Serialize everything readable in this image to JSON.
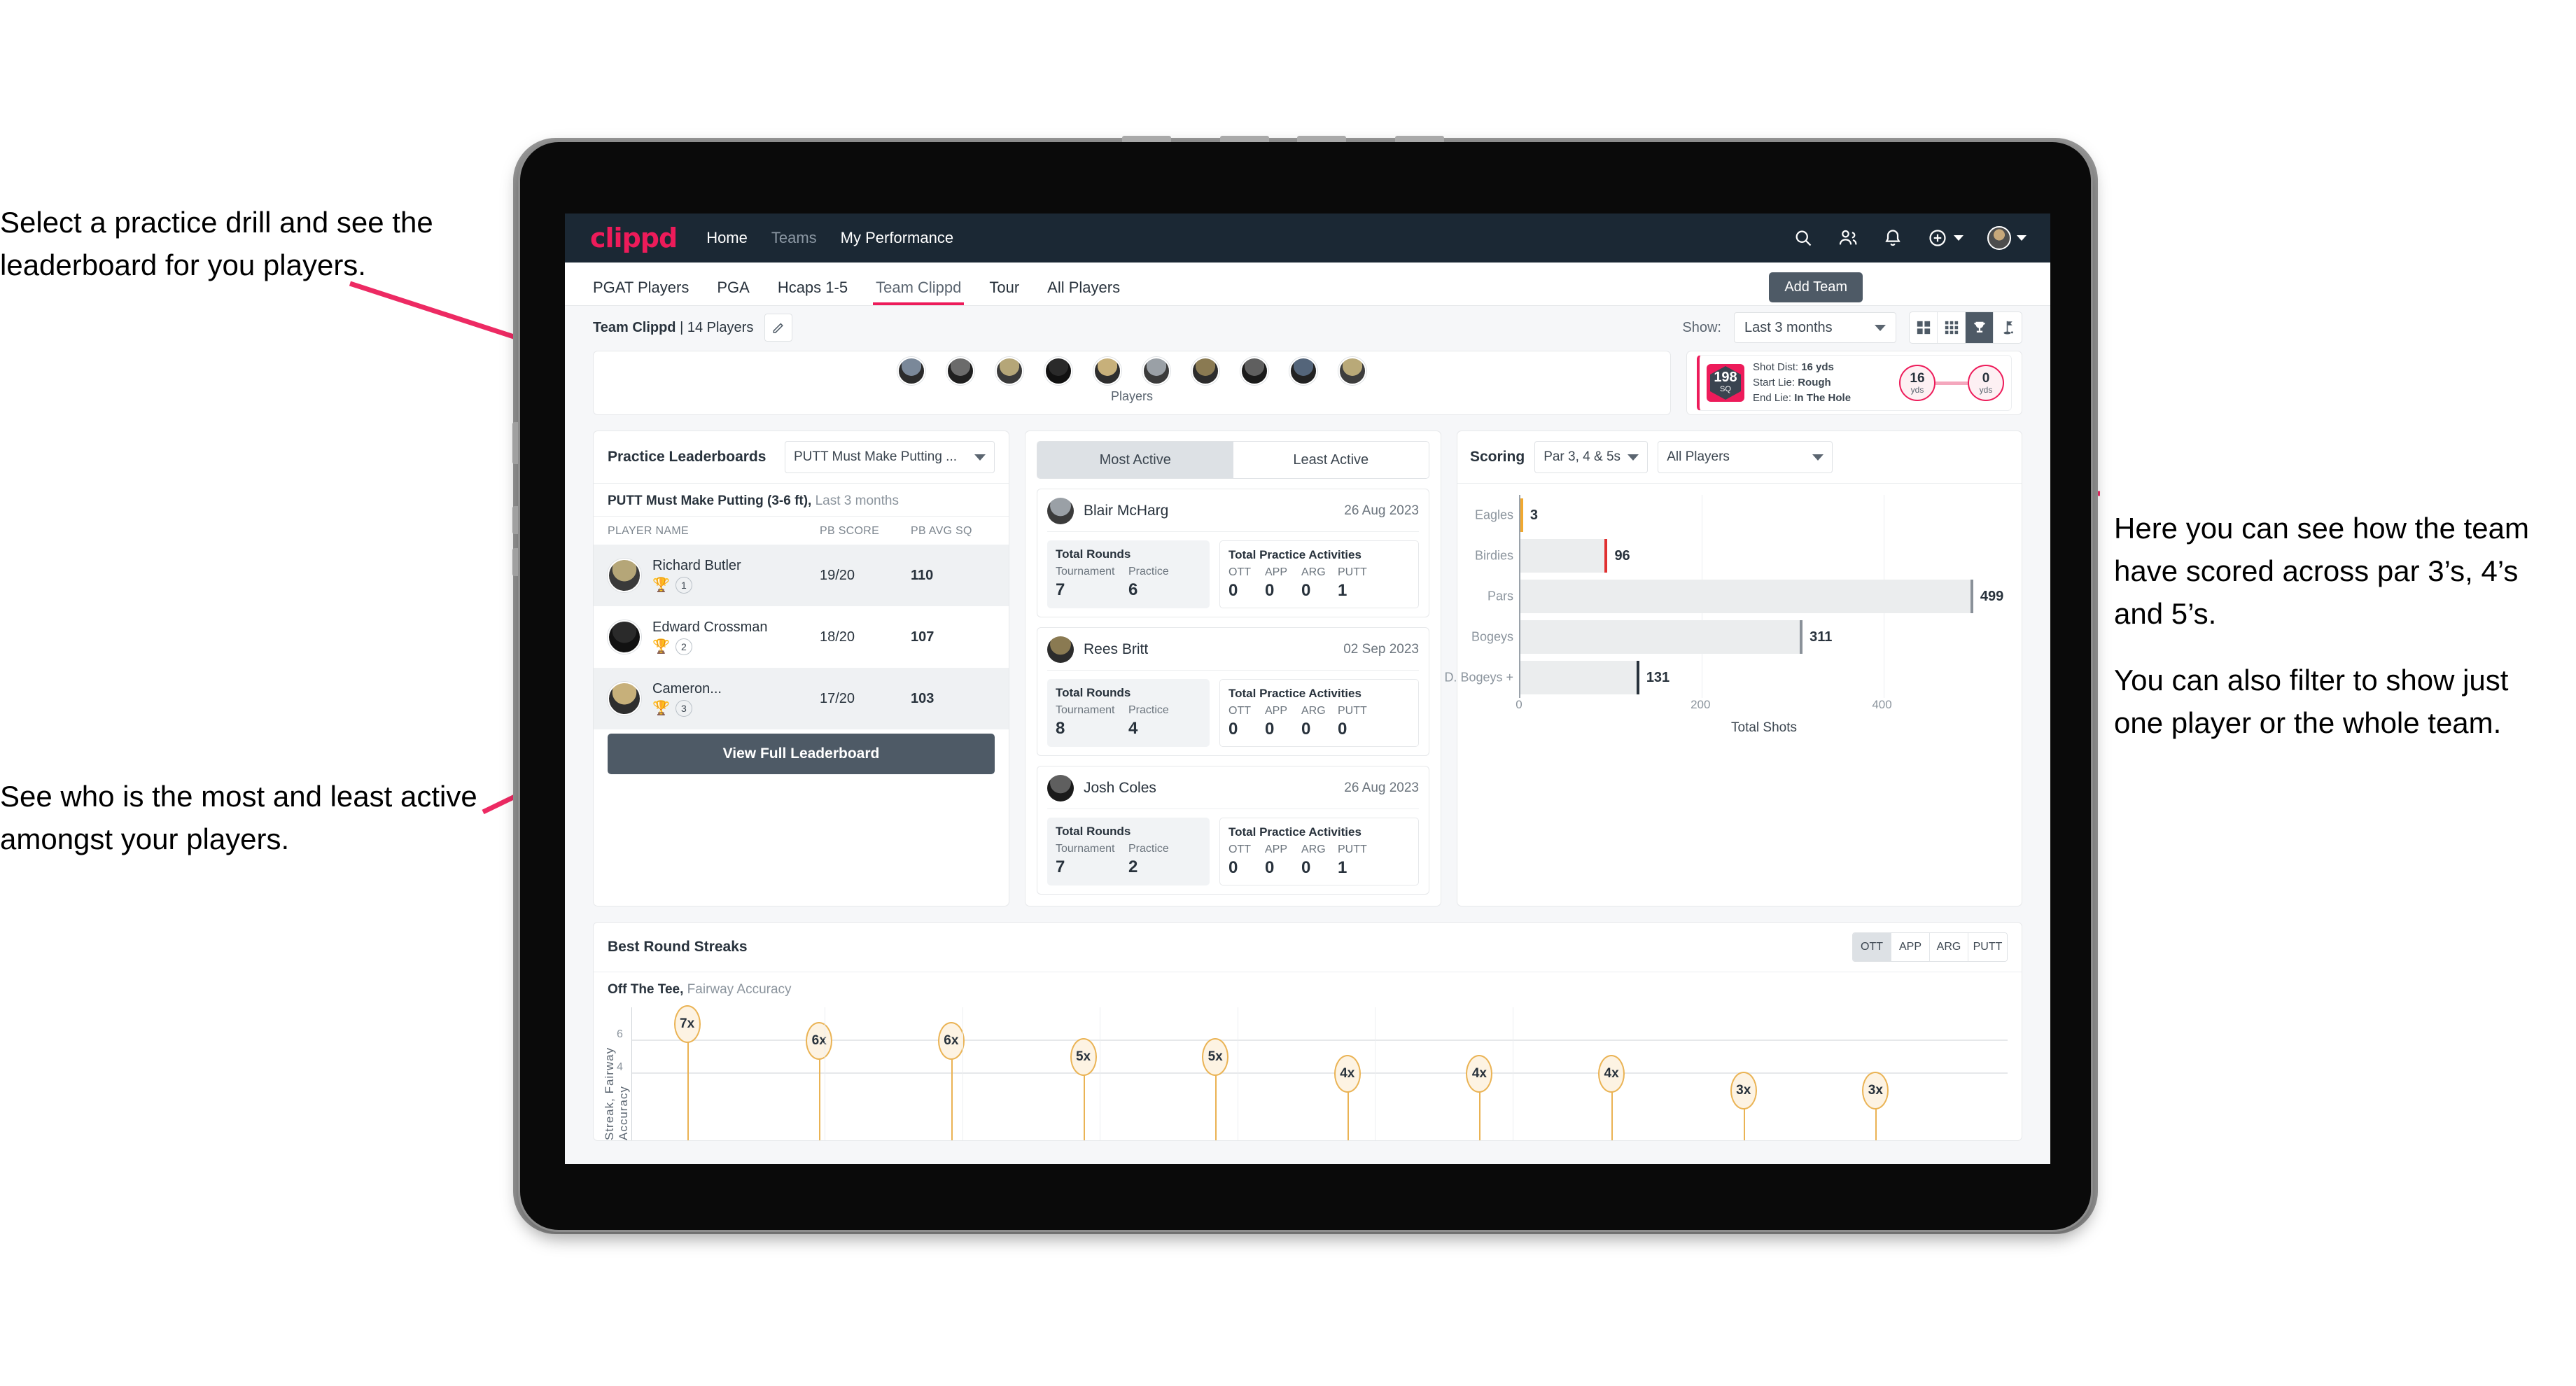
{
  "annotations": {
    "practice": "Select a practice drill and see the leaderboard for you players.",
    "active": "See who is the most and least active amongst your players.",
    "scoring_1": "Here you can see how the team have scored across par 3’s, 4’s and 5’s.",
    "scoring_2": "You can also filter to show just one player or the whole team."
  },
  "topnav": {
    "logo": "clippd",
    "links": [
      {
        "label": "Home",
        "dim": false
      },
      {
        "label": "Teams",
        "dim": true
      },
      {
        "label": "My Performance",
        "dim": false
      }
    ],
    "icons": [
      "search-icon",
      "people-icon",
      "bell-icon",
      "plus-circle-icon",
      "avatar"
    ]
  },
  "tabs": {
    "items": [
      {
        "label": "PGAT Players",
        "state": "normal"
      },
      {
        "label": "PGA",
        "state": "normal"
      },
      {
        "label": "Hcaps 1-5",
        "state": "normal"
      },
      {
        "label": "Team Clippd",
        "state": "active"
      },
      {
        "label": "Tour",
        "state": "normal"
      },
      {
        "label": "All Players",
        "state": "normal"
      }
    ],
    "add_team": "Add Team"
  },
  "subbar": {
    "team_name": "Team Clippd",
    "team_count": "| 14 Players",
    "show_label": "Show:",
    "show_value": "Last 3 months",
    "view_buttons": [
      "grid-large-icon",
      "grid-small-icon",
      "trophy-icon",
      "flag-icon"
    ],
    "view_active_index": 2
  },
  "players_strip": {
    "label": "Players",
    "count": 10
  },
  "shot_card": {
    "sq_value": "198",
    "sq_unit": "SQ",
    "lines": [
      {
        "label": "Shot Dist:",
        "value": "16 yds"
      },
      {
        "label": "Start Lie:",
        "value": "Rough"
      },
      {
        "label": "End Lie:",
        "value": "In The Hole"
      }
    ],
    "start_dist": "16",
    "start_unit": "yds",
    "end_dist": "0",
    "end_unit": "yds"
  },
  "leaderboard": {
    "title": "Practice Leaderboards",
    "drill_select": "PUTT Must Make Putting ...",
    "subtitle_bold": "PUTT Must Make Putting (3-6 ft),",
    "subtitle_light": "Last 3 months",
    "columns": [
      "PLAYER NAME",
      "PB SCORE",
      "PB AVG SQ"
    ],
    "rows": [
      {
        "name": "Richard Butler",
        "rank": "1",
        "trophy": "gold",
        "score": "19/20",
        "avg": "110"
      },
      {
        "name": "Edward Crossman",
        "rank": "2",
        "trophy": "silver",
        "score": "18/20",
        "avg": "107"
      },
      {
        "name": "Cameron...",
        "rank": "3",
        "trophy": "bronze",
        "score": "17/20",
        "avg": "103"
      }
    ],
    "view_full": "View Full Leaderboard"
  },
  "activity": {
    "tabs": [
      {
        "label": "Most Active",
        "active": true
      },
      {
        "label": "Least Active",
        "active": false
      }
    ],
    "rounds_title": "Total Rounds",
    "rounds_cols": [
      "Tournament",
      "Practice"
    ],
    "practice_title": "Total Practice Activities",
    "practice_cols": [
      "OTT",
      "APP",
      "ARG",
      "PUTT"
    ],
    "cards": [
      {
        "name": "Blair McHarg",
        "date": "26 Aug 2023",
        "tournament": "7",
        "practice": "6",
        "ott": "0",
        "app": "0",
        "arg": "0",
        "putt": "1"
      },
      {
        "name": "Rees Britt",
        "date": "02 Sep 2023",
        "tournament": "8",
        "practice": "4",
        "ott": "0",
        "app": "0",
        "arg": "0",
        "putt": "0"
      },
      {
        "name": "Josh Coles",
        "date": "26 Aug 2023",
        "tournament": "7",
        "practice": "2",
        "ott": "0",
        "app": "0",
        "arg": "0",
        "putt": "1"
      }
    ]
  },
  "scoring": {
    "title": "Scoring",
    "select_par": "Par 3, 4 & 5s",
    "select_players": "All Players"
  },
  "streaks": {
    "title": "Best Round Streaks",
    "toggle": [
      {
        "label": "OTT",
        "active": true
      },
      {
        "label": "APP",
        "active": false
      },
      {
        "label": "ARG",
        "active": false
      },
      {
        "label": "PUTT",
        "active": false
      }
    ],
    "sub_bold": "Off The Tee,",
    "sub_light": "Fairway Accuracy",
    "ylabel": "Streak, Fairway Accuracy"
  },
  "chart_data": [
    {
      "type": "bar",
      "orientation": "horizontal",
      "title": "Scoring",
      "categories": [
        "Eagles",
        "Birdies",
        "Pars",
        "Bogeys",
        "D. Bogeys +"
      ],
      "values": [
        3,
        96,
        499,
        311,
        131
      ],
      "cap_colors": [
        "#f0a830",
        "#e03030",
        "#8a9199",
        "#8a9199",
        "#28323c"
      ],
      "xlabel": "Total Shots",
      "ylabel": "",
      "xticks": [
        0,
        200,
        400
      ],
      "xlim": [
        0,
        540
      ],
      "grid": true,
      "legend": "none"
    },
    {
      "type": "scatter",
      "title": "Best Round Streaks",
      "subtitle": "Off The Tee, Fairway Accuracy",
      "ylabel": "Streak, Fairway Accuracy",
      "xlabel": "",
      "labels": [
        "7x",
        "6x",
        "6x",
        "5x",
        "5x",
        "4x",
        "4x",
        "4x",
        "3x",
        "3x"
      ],
      "values": [
        7,
        6,
        6,
        5,
        5,
        4,
        4,
        4,
        3,
        3
      ],
      "yticks": [
        4,
        6
      ],
      "ylim": [
        0,
        8
      ],
      "grid": true,
      "legend": "none"
    }
  ]
}
